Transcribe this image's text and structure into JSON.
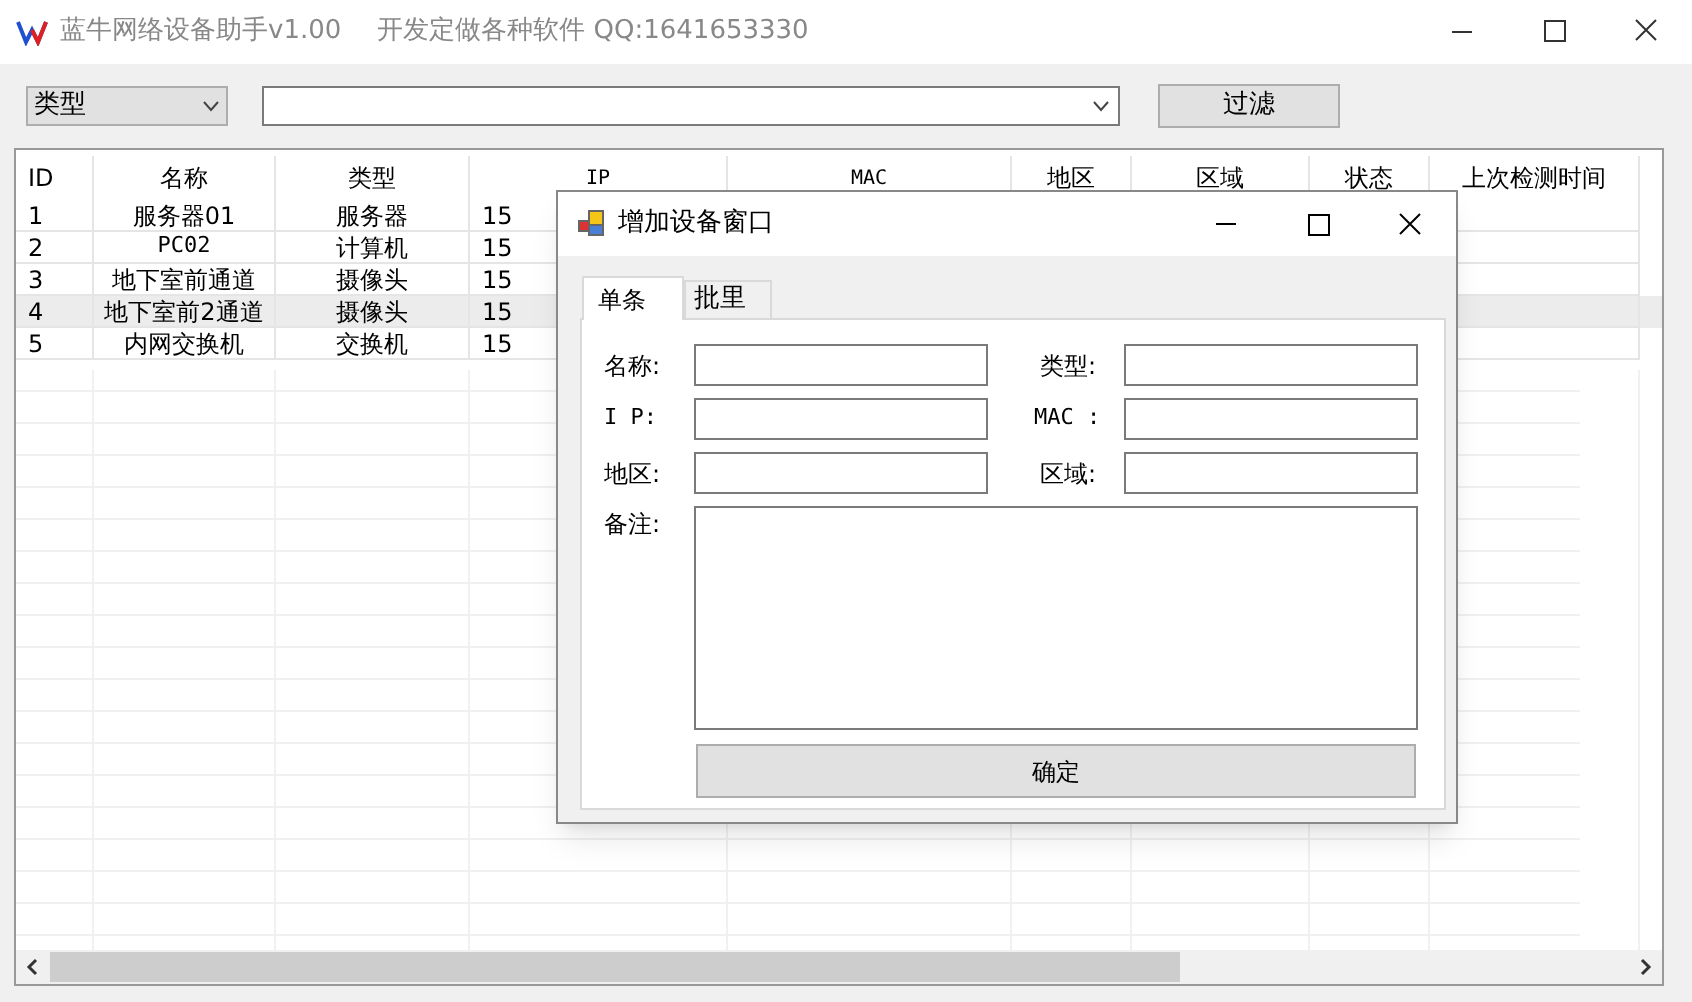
{
  "window": {
    "title": "蓝牛网络设备助手v1.00",
    "subtitle": "开发定做各种软件 QQ:1641653330"
  },
  "toolbar": {
    "type_select": "类型",
    "filter_button": "过滤"
  },
  "table": {
    "columns": [
      "ID",
      "名称",
      "类型",
      "IP",
      "MAC",
      "地区",
      "区域",
      "状态",
      "上次检测时间"
    ],
    "rows": [
      {
        "cells": [
          "1",
          "服务器01",
          "服务器",
          "15"
        ],
        "selected": false
      },
      {
        "cells": [
          "2",
          "PC02",
          "计算机",
          "15"
        ],
        "selected": false
      },
      {
        "cells": [
          "3",
          "地下室前通道",
          "摄像头",
          "15"
        ],
        "selected": false
      },
      {
        "cells": [
          "4",
          "地下室前2通道",
          "摄像头",
          "15"
        ],
        "selected": true
      },
      {
        "cells": [
          "5",
          "内网交换机",
          "交换机",
          "15"
        ],
        "selected": false
      }
    ]
  },
  "dialog": {
    "title": "增加设备窗口",
    "tabs": [
      {
        "label": "单条",
        "selected": true
      },
      {
        "label": "批里",
        "selected": false
      }
    ],
    "fields": [
      {
        "label": "名称:"
      },
      {
        "label": "类型:"
      },
      {
        "label": "I P:"
      },
      {
        "label": "MAC :"
      },
      {
        "label": "地区:"
      },
      {
        "label": "区域:"
      }
    ],
    "note_label": "备注:",
    "confirm_button": "确定"
  }
}
